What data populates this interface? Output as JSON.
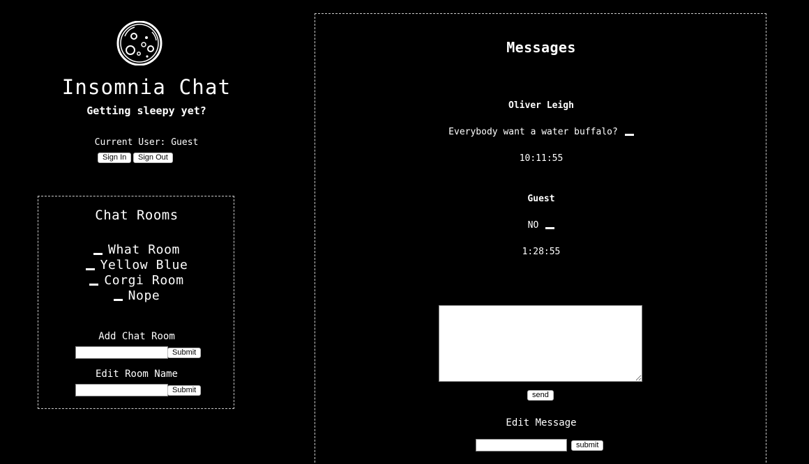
{
  "header": {
    "logo_icon": "moon-icon",
    "app_title": "Insomnia Chat",
    "tagline": "Getting sleepy yet?",
    "current_user_label": "Current User: Guest",
    "sign_in_label": "Sign In",
    "sign_out_label": "Sign Out"
  },
  "rooms": {
    "title": "Chat Rooms",
    "items": [
      {
        "label": "What Room"
      },
      {
        "label": "Yellow Blue"
      },
      {
        "label": "Corgi Room"
      },
      {
        "label": "Nope"
      }
    ],
    "add_label": "Add Chat Room",
    "add_submit_label": "Submit",
    "add_input_value": "",
    "edit_label": "Edit Room Name",
    "edit_submit_label": "Submit",
    "edit_input_value": ""
  },
  "messages": {
    "title": "Messages",
    "items": [
      {
        "author": "Oliver Leigh",
        "content": "Everybody want a water buffalo?",
        "time": "10:11:55"
      },
      {
        "author": "Guest",
        "content": "NO",
        "time": "1:28:55"
      }
    ],
    "compose_value": "",
    "send_label": "send",
    "edit_label": "Edit Message",
    "edit_input_value": "",
    "edit_submit_label": "submit"
  },
  "colors": {
    "background": "#000000",
    "foreground": "#ffffff",
    "panel_border": "#cccccc"
  }
}
